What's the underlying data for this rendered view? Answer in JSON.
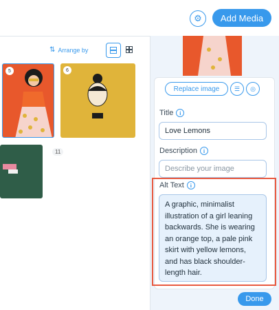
{
  "header": {
    "add_media_label": "Add Media",
    "settings_icon": "gear-icon"
  },
  "toolbar": {
    "arrange_label": "Arrange by"
  },
  "grid": {
    "items": [
      {
        "badge": "5"
      },
      {
        "badge": "6"
      }
    ],
    "count_badge": "11"
  },
  "details": {
    "replace_label": "Replace image",
    "title_label": "Title",
    "title_value": "Love Lemons",
    "description_label": "Description",
    "description_placeholder": "Describe your image",
    "alt_label": "Alt Text",
    "alt_value": "A graphic, minimalist illustration of a girl leaning backwards. She is wearing an orange top, a pale pink skirt with yellow lemons, and has black shoulder-length hair.",
    "done_label": "Done"
  },
  "colors": {
    "accent": "#3899ec",
    "highlight": "#e8593f",
    "orange": "#e8582c",
    "mustard": "#e0b43a",
    "green": "#2f5d48"
  }
}
